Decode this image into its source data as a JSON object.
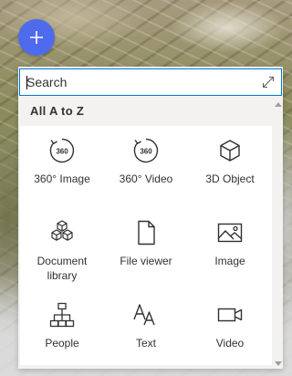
{
  "add_button": {
    "icon": "plus-icon",
    "color": "#4f6bed"
  },
  "search": {
    "placeholder": "Search",
    "value": "",
    "expand_icon": "expand-icon"
  },
  "section": {
    "title": "All A to Z"
  },
  "tiles": [
    {
      "label": "360° Image",
      "icon": "360-image-icon"
    },
    {
      "label": "360° Video",
      "icon": "360-video-icon"
    },
    {
      "label": "3D Object",
      "icon": "3d-object-icon"
    },
    {
      "label": "Document library",
      "icon": "document-library-icon"
    },
    {
      "label": "File viewer",
      "icon": "file-viewer-icon"
    },
    {
      "label": "Image",
      "icon": "image-icon"
    },
    {
      "label": "People",
      "icon": "people-icon"
    },
    {
      "label": "Text",
      "icon": "text-icon"
    },
    {
      "label": "Video",
      "icon": "video-icon"
    }
  ],
  "colors": {
    "accent": "#0078d4",
    "panel": "#f3f2f1",
    "text": "#323130"
  }
}
